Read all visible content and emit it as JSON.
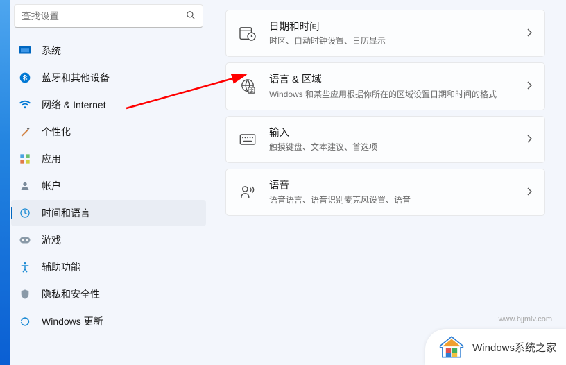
{
  "search": {
    "placeholder": "查找设置"
  },
  "sidebar": {
    "items": [
      {
        "label": "系统"
      },
      {
        "label": "蓝牙和其他设备"
      },
      {
        "label": "网络 & Internet"
      },
      {
        "label": "个性化"
      },
      {
        "label": "应用"
      },
      {
        "label": "帐户"
      },
      {
        "label": "时间和语言"
      },
      {
        "label": "游戏"
      },
      {
        "label": "辅助功能"
      },
      {
        "label": "隐私和安全性"
      },
      {
        "label": "Windows 更新"
      }
    ]
  },
  "cards": [
    {
      "title": "日期和时间",
      "sub": "时区、自动时钟设置、日历显示"
    },
    {
      "title": "语言 & 区域",
      "sub": "Windows 和某些应用根据你所在的区域设置日期和时间的格式"
    },
    {
      "title": "输入",
      "sub": "触摸键盘、文本建议、首选项"
    },
    {
      "title": "语音",
      "sub": "语音语言、语音识别麦克风设置、语音"
    }
  ],
  "watermark": {
    "text": "Windows系统之家",
    "url": "www.bjjmlv.com"
  }
}
